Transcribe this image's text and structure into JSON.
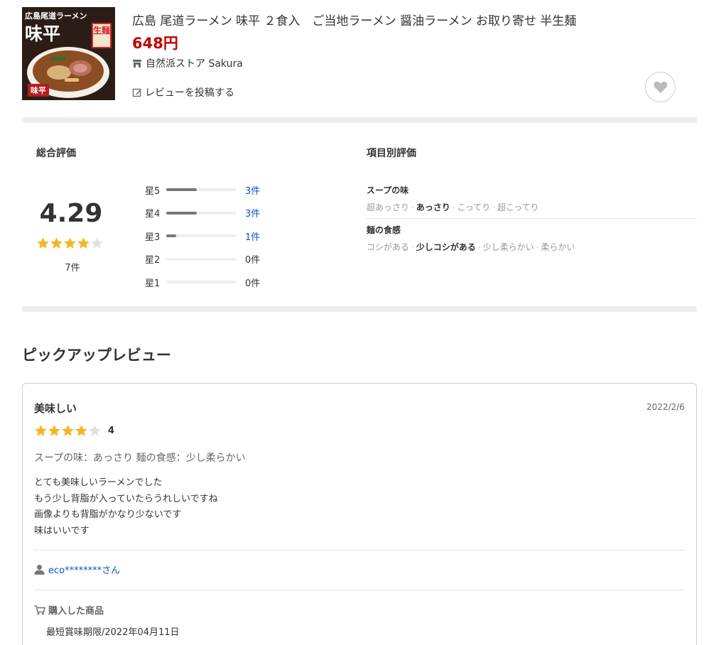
{
  "product": {
    "image": {
      "shop_text": "広島尾道ラーメン",
      "brand_text": "味平",
      "stamp_text": "生麺",
      "label_text": "味平"
    },
    "title": "広島 尾道ラーメン 味平 ２食入　ご当地ラーメン 醤油ラーメン お取り寄せ 半生麺",
    "price": "648円",
    "shop_name": "自然派ストア Sakura",
    "write_review_label": "レビューを投稿する"
  },
  "summary": {
    "overall_heading": "総合評価",
    "score": "4.29",
    "score_value": 4.29,
    "count": "7件",
    "distribution": [
      {
        "label": "星5",
        "count": "3件",
        "fraction": 0.43,
        "linked": true
      },
      {
        "label": "星4",
        "count": "3件",
        "fraction": 0.43,
        "linked": true
      },
      {
        "label": "星3",
        "count": "1件",
        "fraction": 0.14,
        "linked": true
      },
      {
        "label": "星2",
        "count": "0件",
        "fraction": 0,
        "linked": false
      },
      {
        "label": "星1",
        "count": "0件",
        "fraction": 0,
        "linked": false
      }
    ],
    "items_heading": "項目別評価",
    "items": [
      {
        "name": "スープの味",
        "options": [
          "超あっさり",
          "あっさり",
          "こってり",
          "超こってり"
        ],
        "selected": 1
      },
      {
        "name": "麺の食感",
        "options": [
          "コシがある",
          "少しコシがある",
          "少し柔らかい",
          "柔らかい"
        ],
        "selected": 1
      }
    ]
  },
  "pickup": {
    "heading": "ピックアップレビュー",
    "review": {
      "title": "美味しい",
      "date": "2022/2/6",
      "rating": 4,
      "rating_label": "4",
      "attributes": "スープの味：あっさり 麺の食感：少し柔らかい",
      "body_lines": [
        "とても美味しいラーメンでした",
        "もう少し背脂が入っていたらうれしいですね",
        "画像よりも背脂がかなり少ないです",
        "味はいいです"
      ],
      "reviewer": "eco********さん",
      "purchased_heading": "購入した商品",
      "purchased_item": "最短賞味期限/2022年04月11日"
    }
  },
  "colors": {
    "price": "#bf0000",
    "star_filled": "#f5b523",
    "star_empty": "#e0e0e0",
    "link": "#0a55c4",
    "bar_fill": "#777777"
  }
}
